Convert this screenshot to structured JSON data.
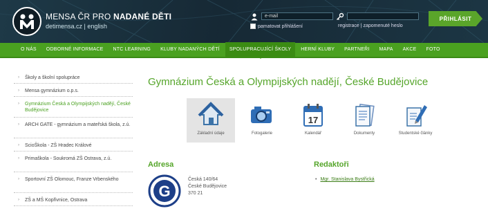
{
  "header": {
    "brand_prefix": "MENSA ČR PRO ",
    "brand_bold": "NADANÉ DĚTI",
    "lang_cs": "detimensa.cz",
    "lang_sep": " | ",
    "lang_en": "english",
    "email_placeholder": "e-mail",
    "remember_label": "pamatovat přihlášení",
    "register_link": "registrace",
    "forgot_link": "zapomenuté heslo",
    "login_button": "PŘIHLÁSIT"
  },
  "nav": {
    "items": [
      "O NÁS",
      "ODBORNÉ INFORMACE",
      "NTC LEARNING",
      "KLUBY NADANÝCH DĚTÍ",
      "SPOLUPRACUJÍCÍ ŠKOLY",
      "HERNÍ KLUBY",
      "PARTNEŘI",
      "MAPA",
      "AKCE",
      "FOTO"
    ],
    "active_index": 4
  },
  "sidebar": {
    "items": [
      {
        "label": "Školy a školní spolupráce"
      },
      {
        "label": "Mensa gymnázium o.p.s."
      },
      {
        "label": "Gymnázium Česká a Olympijských nadějí, České Budějovice",
        "active": true
      },
      {
        "label": "ARCH GATE - gymnázium a mateřská škola, z.ú."
      },
      {
        "label": "ScioŠkola - ZŠ Hradec Králové"
      },
      {
        "label": "Primaškola - Soukromá ZŠ Ostrava, z.ú."
      },
      {
        "label": "Sportovní ZŠ Olomouc, Franze Vrbenského"
      },
      {
        "label": "ZŠ a MŠ Kopřivnice, Ostrava"
      }
    ]
  },
  "main": {
    "title": "Gymnázium Česká a Olympijských nadějí, České Budějovice",
    "tiles": [
      {
        "label": "Základní údaje",
        "icon": "house-icon",
        "active": true
      },
      {
        "label": "Fotogalerie",
        "icon": "camera-icon"
      },
      {
        "label": "Kalendář",
        "icon": "calendar-icon"
      },
      {
        "label": "Dokumenty",
        "icon": "documents-icon"
      },
      {
        "label": "Studentské články",
        "icon": "pen-document-icon"
      }
    ],
    "address_heading": "Adresa",
    "address_lines": [
      "Česká 140/64",
      "České Budějovice",
      "370 21"
    ],
    "editor_heading": "Redaktoři",
    "editor_name": "Mgr. Stanislava Bystřická"
  },
  "colors": {
    "green": "#4aa120",
    "header_bg": "#1b3442",
    "title_green": "#55a52a"
  }
}
